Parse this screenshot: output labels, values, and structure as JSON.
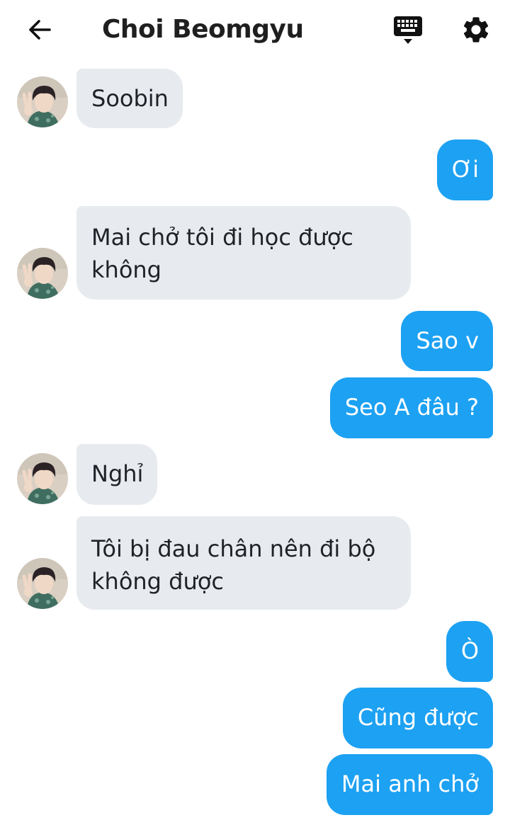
{
  "header": {
    "title": "Choi Beomgyu"
  },
  "colors": {
    "incoming_bubble": "#e7ebef",
    "outgoing_bubble": "#1da1f2",
    "outgoing_text": "#ffffff"
  },
  "icons": {
    "back": "arrow-left-icon",
    "keyboard": "keyboard-icon",
    "settings": "gear-icon"
  },
  "messages": [
    {
      "sender": "them",
      "text": "Soobin"
    },
    {
      "sender": "me",
      "text": "Ơi"
    },
    {
      "sender": "them",
      "text": "Mai chở tôi đi học được không"
    },
    {
      "sender": "me",
      "text": "Sao v"
    },
    {
      "sender": "me",
      "text": "Seo A đâu ?"
    },
    {
      "sender": "them",
      "text": "Nghỉ"
    },
    {
      "sender": "them",
      "text": "Tôi bị đau chân nên đi bộ không được"
    },
    {
      "sender": "me",
      "text": "Ò"
    },
    {
      "sender": "me",
      "text": "Cũng được"
    },
    {
      "sender": "me",
      "text": "Mai anh chở"
    }
  ]
}
